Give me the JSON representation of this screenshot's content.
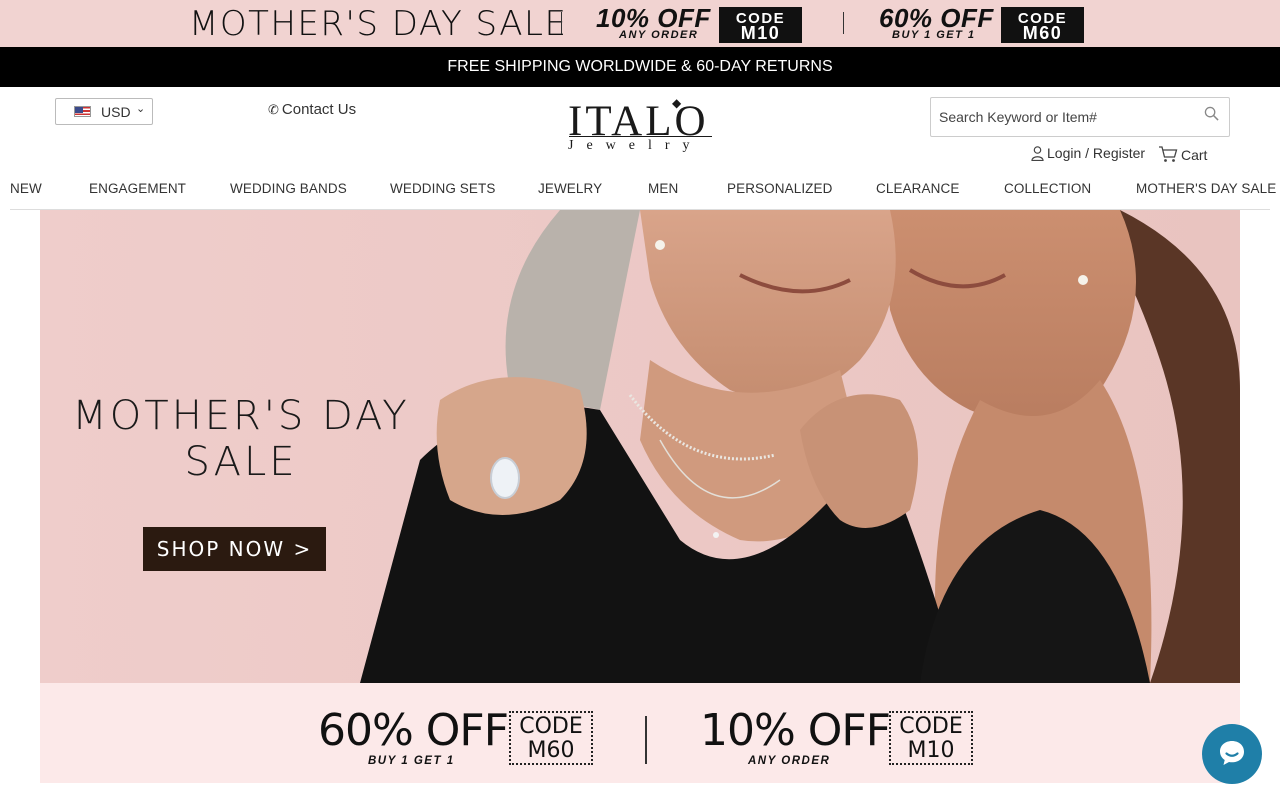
{
  "promo": {
    "title": "MOTHER'S DAY SALE",
    "offer1": {
      "big": "10% OFF",
      "small": "ANY ORDER",
      "code_label": "CODE",
      "code": "M10"
    },
    "offer2": {
      "big": "60% OFF",
      "small": "BUY 1 GET 1",
      "code_label": "CODE",
      "code": "M60"
    }
  },
  "shipping_bar": "FREE SHIPPING WORLDWIDE & 60-DAY RETURNS",
  "header": {
    "currency": "USD",
    "contact": "Contact Us",
    "logo": {
      "word": "ITALO",
      "sub": "Jewelry"
    },
    "search": {
      "placeholder": "Search Keyword or Item#"
    },
    "account": "Login / Register",
    "cart": "Cart"
  },
  "nav": {
    "items": [
      "NEW",
      "ENGAGEMENT",
      "WEDDING BANDS",
      "WEDDING SETS",
      "JEWELRY",
      "MEN",
      "PERSONALIZED",
      "CLEARANCE",
      "COLLECTION",
      "MOTHER'S DAY SALE"
    ]
  },
  "hero": {
    "headline_line1": "MOTHER'S DAY",
    "headline_line2": "SALE",
    "cta": "SHOP NOW >"
  },
  "offers": [
    {
      "pct": "60% OFF",
      "small": "BUY 1 GET 1",
      "code_label": "CODE",
      "code": "M60"
    },
    {
      "pct": "10% OFF",
      "small": "ANY ORDER",
      "code_label": "CODE",
      "code": "M10"
    }
  ],
  "colors": {
    "promo_bg": "#f1d3d1",
    "hero_bg": "#efcdcb",
    "cta_bg": "#2b1a10",
    "offer_strip_bg": "#fce9e9",
    "chat_bg": "#1f7fa8"
  }
}
